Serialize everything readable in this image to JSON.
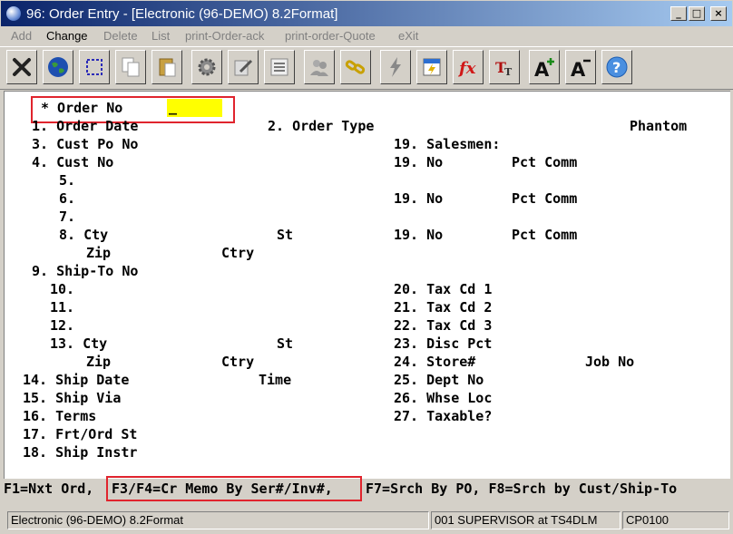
{
  "window": {
    "title": "96: Order Entry - [Electronic (96-DEMO) 8.2Format]",
    "minimize": "_",
    "maximize": "□",
    "close": "×"
  },
  "menu": [
    {
      "label": "Add",
      "enabled": false
    },
    {
      "label": "Change",
      "enabled": true
    },
    {
      "label": "Delete",
      "enabled": false
    },
    {
      "label": "List",
      "enabled": false
    },
    {
      "label": "print-Order-ack",
      "enabled": false
    },
    {
      "label": "print-order-Quote",
      "enabled": false
    },
    {
      "label": "eXit",
      "enabled": false
    }
  ],
  "toolbar": [
    "exit-icon",
    "globe-icon",
    "select-icon",
    "copy-icon",
    "paste-icon",
    "settings-icon",
    "edit-icon",
    "list-icon",
    "users-icon",
    "link-icon",
    "lightning-icon",
    "calendar-icon",
    "function-icon",
    "font-type-icon",
    "font-larger-icon",
    "font-smaller-icon",
    "help-icon"
  ],
  "form": {
    "order_no_label": "* Order No",
    "order_no_value": "_",
    "l1": "1. Order Date",
    "l2": "2. Order Type",
    "phantom": "Phantom",
    "l3": "3. Cust Po No",
    "l19s": "19. Salesmen:",
    "l4": "4. Cust No",
    "l19a": "19. No",
    "pct_comm": "Pct Comm",
    "l5": "5.",
    "l6": "6.",
    "l19b": "19. No",
    "l7": "7.",
    "l8": "8. Cty",
    "st": "St",
    "l19c": "19. No",
    "zip": "Zip",
    "ctry": "Ctry",
    "l9": "9. Ship-To No",
    "l10": "10.",
    "l20": "20. Tax Cd 1",
    "l11": "11.",
    "l21": "21. Tax Cd 2",
    "l12": "12.",
    "l22": "22. Tax Cd 3",
    "l13": "13. Cty",
    "l23": "23. Disc Pct",
    "l24": "24. Store#",
    "job_no": "Job No",
    "l14": "14. Ship Date",
    "time": "Time",
    "l25": "25. Dept No",
    "l15": "15. Ship Via",
    "l26": "26. Whse Loc",
    "l16": "16. Terms",
    "l27": "27. Taxable?",
    "l17": "17. Frt/Ord St",
    "l18": "18. Ship Instr"
  },
  "fkeys": {
    "f1": "F1=Nxt Ord,",
    "f3f4": "F3/F4=Cr Memo By Ser#/Inv#,",
    "f7f8": "F7=Srch By PO, F8=Srch by Cust/Ship-To"
  },
  "status": {
    "company": "Electronic (96-DEMO) 8.2Format",
    "user": "001 SUPERVISOR at TS4DLM",
    "program": "CP0100"
  }
}
